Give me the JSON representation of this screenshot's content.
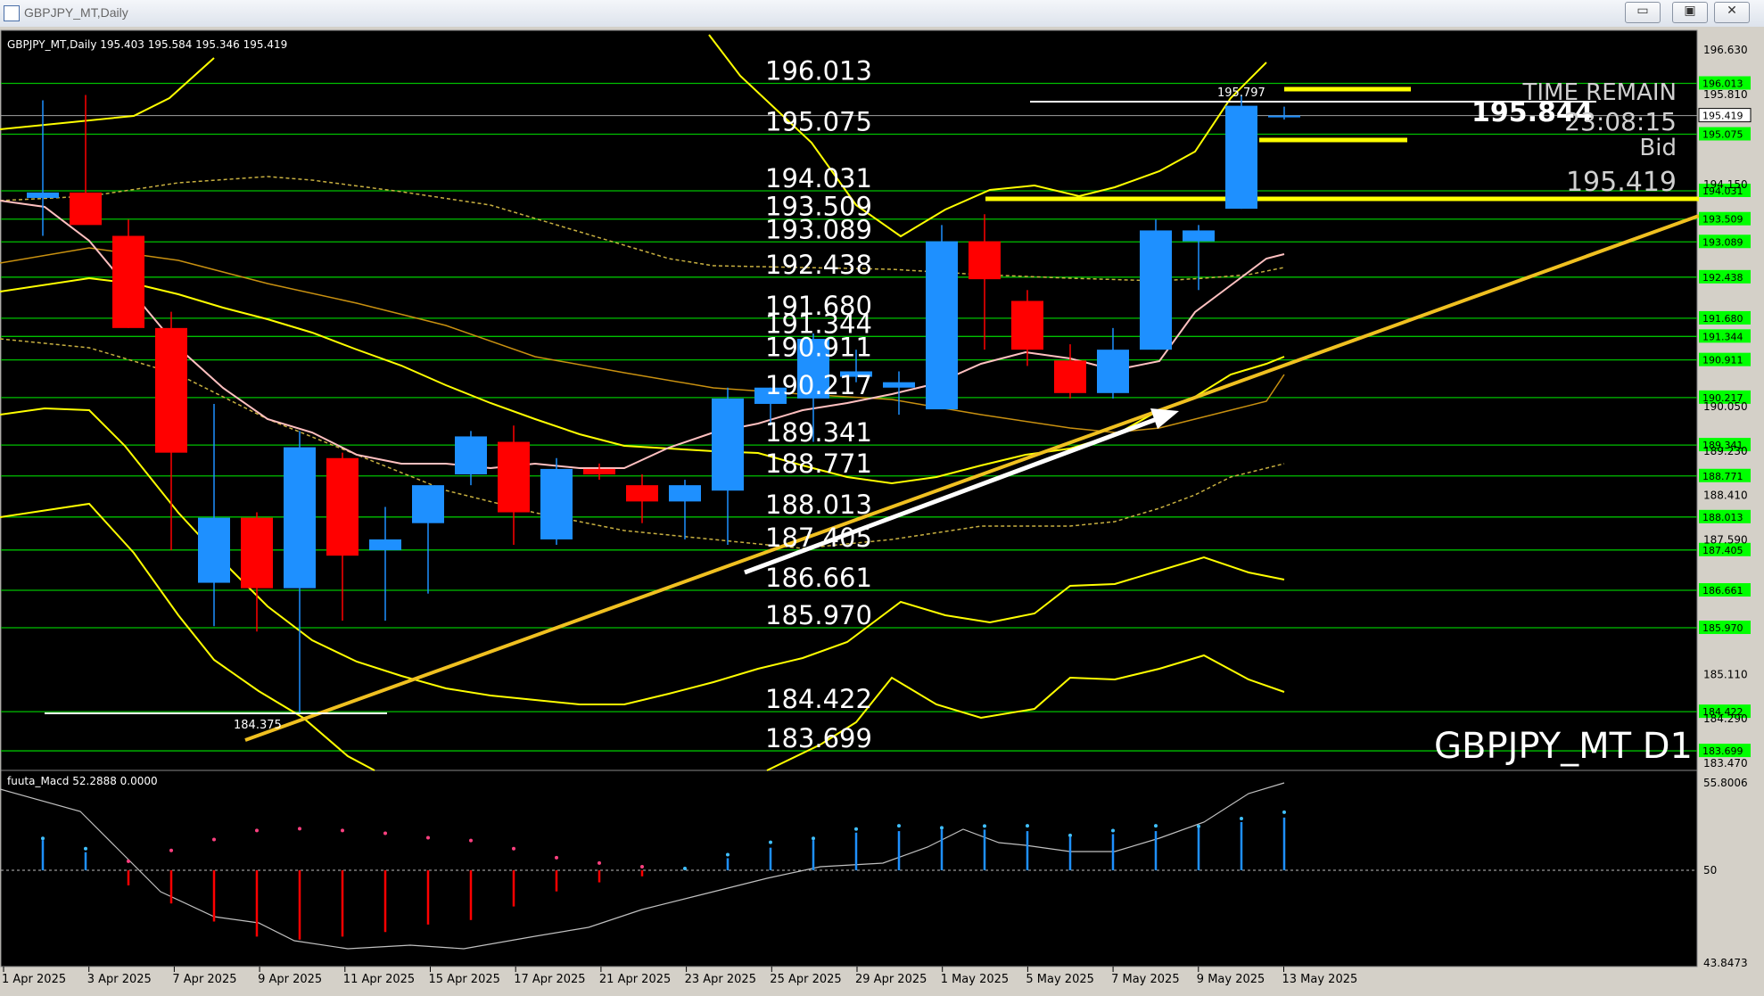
{
  "window": {
    "title": "GBPJPY_MT,Daily",
    "minimize_label": "▭",
    "restore_label": "▣",
    "close_label": "✕"
  },
  "info_line": "GBPJPY_MT,Daily  195.403 195.584 195.346 195.419",
  "watermark": "GBPJPY_MT D1",
  "timer": {
    "label": "TIME REMAIN",
    "value": "23:08:15",
    "bid_label": "Bid",
    "bid_value": "195.419",
    "price_big": "195.844"
  },
  "colors": {
    "bull": "#1e90ff",
    "bear": "#ff0000",
    "level": "#00c000",
    "band": "#ffff00",
    "trend": "#f0c020",
    "ma": "#ffc0c0",
    "axis_tag": "#00ff00"
  },
  "chart_data": {
    "type": "candlestick",
    "ylim": [
      183.47,
      196.63
    ],
    "x_labels": [
      "1 Apr 2025",
      "3 Apr 2025",
      "7 Apr 2025",
      "9 Apr 2025",
      "11 Apr 2025",
      "15 Apr 2025",
      "17 Apr 2025",
      "21 Apr 2025",
      "23 Apr 2025",
      "25 Apr 2025",
      "29 Apr 2025",
      "1 May 2025",
      "5 May 2025",
      "7 May 2025",
      "9 May 2025",
      "13 May 2025"
    ],
    "candles": [
      {
        "o": 193.9,
        "h": 195.7,
        "l": 193.2,
        "c": 194.0
      },
      {
        "o": 194.0,
        "h": 195.8,
        "l": 193.5,
        "c": 193.4
      },
      {
        "o": 193.2,
        "h": 193.5,
        "l": 191.5,
        "c": 191.5
      },
      {
        "o": 191.5,
        "h": 191.8,
        "l": 187.4,
        "c": 189.2
      },
      {
        "o": 186.8,
        "h": 190.1,
        "l": 186.0,
        "c": 188.0
      },
      {
        "o": 188.0,
        "h": 188.1,
        "l": 185.9,
        "c": 186.7
      },
      {
        "o": 186.7,
        "h": 189.6,
        "l": 184.4,
        "c": 189.3
      },
      {
        "o": 189.1,
        "h": 189.2,
        "l": 186.1,
        "c": 187.3
      },
      {
        "o": 187.4,
        "h": 188.2,
        "l": 186.1,
        "c": 187.6
      },
      {
        "o": 187.9,
        "h": 188.3,
        "l": 186.6,
        "c": 188.6
      },
      {
        "o": 188.8,
        "h": 189.6,
        "l": 188.6,
        "c": 189.5
      },
      {
        "o": 189.4,
        "h": 189.7,
        "l": 187.5,
        "c": 188.1
      },
      {
        "o": 187.6,
        "h": 189.1,
        "l": 187.5,
        "c": 188.9
      },
      {
        "o": 188.9,
        "h": 189.0,
        "l": 188.7,
        "c": 188.8
      },
      {
        "o": 188.6,
        "h": 188.8,
        "l": 187.9,
        "c": 188.3
      },
      {
        "o": 188.3,
        "h": 188.7,
        "l": 187.6,
        "c": 188.6
      },
      {
        "o": 188.5,
        "h": 190.4,
        "l": 187.5,
        "c": 190.2
      },
      {
        "o": 190.1,
        "h": 190.4,
        "l": 189.7,
        "c": 190.4
      },
      {
        "o": 190.2,
        "h": 191.4,
        "l": 189.4,
        "c": 191.3
      },
      {
        "o": 190.6,
        "h": 191.1,
        "l": 190.5,
        "c": 190.7
      },
      {
        "o": 190.4,
        "h": 190.7,
        "l": 189.9,
        "c": 190.5
      },
      {
        "o": 190.0,
        "h": 193.4,
        "l": 190.0,
        "c": 193.1
      },
      {
        "o": 193.1,
        "h": 193.6,
        "l": 191.1,
        "c": 192.4
      },
      {
        "o": 192.0,
        "h": 192.2,
        "l": 190.8,
        "c": 191.1
      },
      {
        "o": 190.9,
        "h": 191.2,
        "l": 190.2,
        "c": 190.3
      },
      {
        "o": 190.3,
        "h": 191.5,
        "l": 190.2,
        "c": 191.1
      },
      {
        "o": 191.1,
        "h": 193.5,
        "l": 191.1,
        "c": 193.3
      },
      {
        "o": 193.1,
        "h": 193.4,
        "l": 192.2,
        "c": 193.3
      },
      {
        "o": 193.7,
        "h": 195.8,
        "l": 193.7,
        "c": 195.6
      },
      {
        "o": 195.403,
        "h": 195.584,
        "l": 195.346,
        "c": 195.419
      }
    ],
    "levels": [
      196.013,
      195.075,
      194.031,
      193.509,
      193.089,
      192.438,
      191.68,
      191.344,
      190.911,
      190.217,
      189.341,
      188.771,
      188.013,
      187.405,
      186.661,
      185.97,
      184.422,
      183.699
    ],
    "level_labels": [
      "196.013",
      "195.075",
      "194.031",
      "193.509",
      "193.089",
      "192.438",
      "191.680",
      "191.344",
      "190.911",
      "190.217",
      "189.341",
      "188.771",
      "188.013",
      "187.405",
      "186.661",
      "185.970",
      "184.422",
      "183.699"
    ],
    "axis_ticks": [
      "196.630",
      "195.810",
      "194.150",
      "190.050",
      "189.230",
      "188.410",
      "187.590",
      "185.110",
      "184.290",
      "183.470"
    ],
    "current_price": "195.419",
    "low_marker": "184.375",
    "high_marker": "195.797",
    "macd": {
      "label": "fuuta_Macd 52.2888  0.0000",
      "ylim": [
        43.8473,
        55.8006
      ],
      "ticks": [
        "55.8006",
        "50",
        "43.8473"
      ],
      "hist": [
        52.0,
        51.2,
        49.0,
        47.8,
        46.6,
        45.6,
        45.4,
        45.6,
        45.9,
        46.4,
        46.7,
        47.6,
        48.6,
        49.2,
        49.6,
        50.0,
        50.8,
        51.5,
        52.0,
        52.5,
        52.6,
        52.7,
        52.7,
        52.6,
        52.2,
        52.4,
        52.6,
        52.8,
        53.2,
        53.5
      ]
    }
  }
}
